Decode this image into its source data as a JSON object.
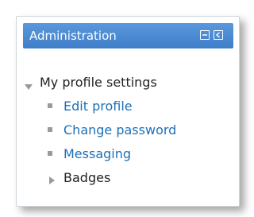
{
  "block": {
    "title": "Administration",
    "dock_icon": "dock-icon",
    "hide_icon": "hide-block-icon"
  },
  "tree": {
    "root": {
      "label": "My profile settings",
      "expanded": true,
      "icon": "expanded-triangle-icon"
    },
    "items": [
      {
        "label": "Edit profile",
        "type": "link"
      },
      {
        "label": "Change password",
        "type": "link"
      },
      {
        "label": "Messaging",
        "type": "link"
      }
    ],
    "branch": {
      "label": "Badges",
      "expanded": false,
      "icon": "collapsed-triangle-icon"
    }
  },
  "colors": {
    "header": "#4f8fd6",
    "link": "#1d6fb8",
    "text": "#222222",
    "bullet": "#9a9a9a"
  }
}
